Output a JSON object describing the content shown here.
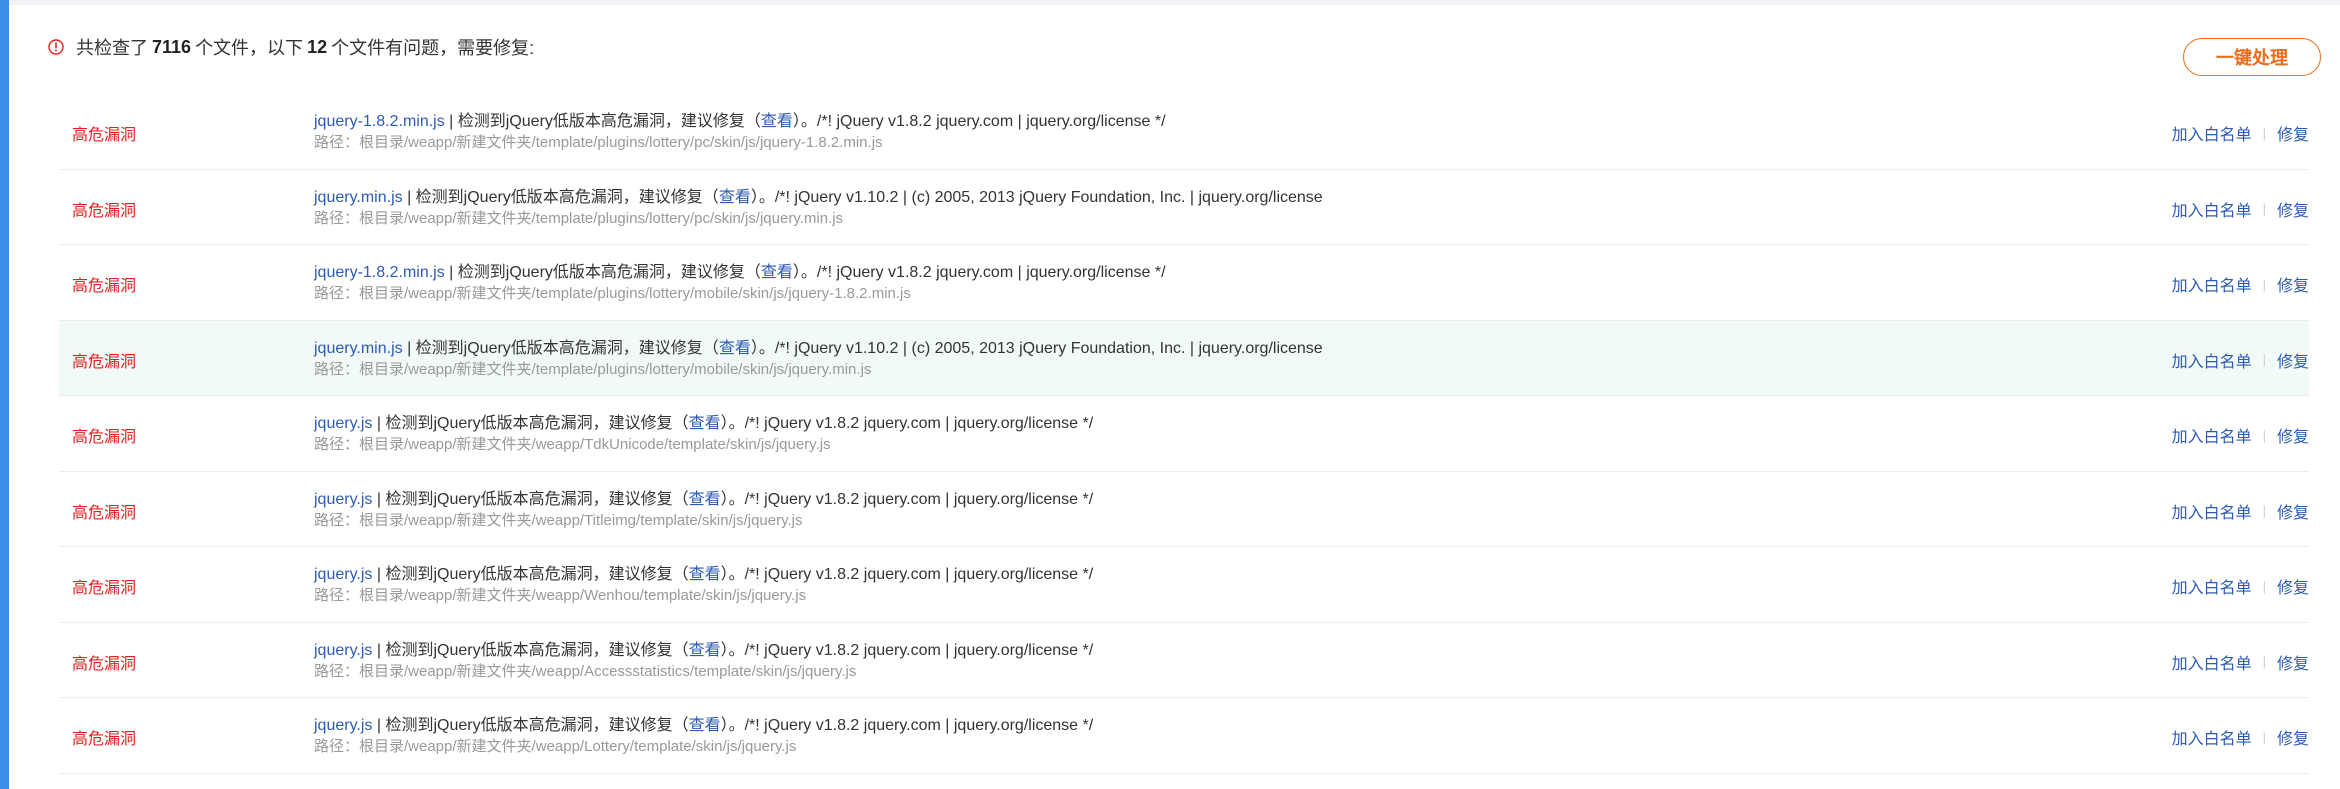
{
  "summary": {
    "prefix": "共检查了",
    "total": "7116",
    "mid": "个文件，以下",
    "issues": "12",
    "suffix": "个文件有问题，需要修复:"
  },
  "colors": {
    "danger": "#e02020",
    "link": "#2d5bb3",
    "accent": "#f06b16",
    "sidebar": "#3a8ee6"
  },
  "icons": {
    "summary": "warning-circle-icon"
  },
  "actions": {
    "one_click": "一键处理",
    "whitelist": "加入白名单",
    "fix": "修复",
    "separator": "|"
  },
  "rows": [
    {
      "level": "高危漏洞",
      "file": "jquery-1.8.2.min.js",
      "sep": " | ",
      "message": "检测到jQuery低版本高危漏洞，建议修复（",
      "view": "查看",
      "after": "）。/*! jQuery v1.8.2 jquery.com | jquery.org/license */",
      "path": "路径：根目录/weapp/新建文件夹/template/plugins/lottery/pc/skin/js/jquery-1.8.2.min.js"
    },
    {
      "level": "高危漏洞",
      "file": "jquery.min.js",
      "sep": " | ",
      "message": "检测到jQuery低版本高危漏洞，建议修复（",
      "view": "查看",
      "after": "）。/*! jQuery v1.10.2 | (c) 2005, 2013 jQuery Foundation, Inc. | jquery.org/license",
      "path": "路径：根目录/weapp/新建文件夹/template/plugins/lottery/pc/skin/js/jquery.min.js"
    },
    {
      "level": "高危漏洞",
      "file": "jquery-1.8.2.min.js",
      "sep": " | ",
      "message": "检测到jQuery低版本高危漏洞，建议修复（",
      "view": "查看",
      "after": "）。/*! jQuery v1.8.2 jquery.com | jquery.org/license */",
      "path": "路径：根目录/weapp/新建文件夹/template/plugins/lottery/mobile/skin/js/jquery-1.8.2.min.js"
    },
    {
      "level": "高危漏洞",
      "file": "jquery.min.js",
      "sep": " | ",
      "message": "检测到jQuery低版本高危漏洞，建议修复（",
      "view": "查看",
      "after": "）。/*! jQuery v1.10.2 | (c) 2005, 2013 jQuery Foundation, Inc. | jquery.org/license",
      "path": "路径：根目录/weapp/新建文件夹/template/plugins/lottery/mobile/skin/js/jquery.min.js"
    },
    {
      "level": "高危漏洞",
      "file": "jquery.js",
      "sep": " | ",
      "message": "检测到jQuery低版本高危漏洞，建议修复（",
      "view": "查看",
      "after": "）。/*! jQuery v1.8.2 jquery.com | jquery.org/license */",
      "path": "路径：根目录/weapp/新建文件夹/weapp/TdkUnicode/template/skin/js/jquery.js"
    },
    {
      "level": "高危漏洞",
      "file": "jquery.js",
      "sep": " | ",
      "message": "检测到jQuery低版本高危漏洞，建议修复（",
      "view": "查看",
      "after": "）。/*! jQuery v1.8.2 jquery.com | jquery.org/license */",
      "path": "路径：根目录/weapp/新建文件夹/weapp/Titleimg/template/skin/js/jquery.js"
    },
    {
      "level": "高危漏洞",
      "file": "jquery.js",
      "sep": " | ",
      "message": "检测到jQuery低版本高危漏洞，建议修复（",
      "view": "查看",
      "after": "）。/*! jQuery v1.8.2 jquery.com | jquery.org/license */",
      "path": "路径：根目录/weapp/新建文件夹/weapp/Wenhou/template/skin/js/jquery.js"
    },
    {
      "level": "高危漏洞",
      "file": "jquery.js",
      "sep": " | ",
      "message": "检测到jQuery低版本高危漏洞，建议修复（",
      "view": "查看",
      "after": "）。/*! jQuery v1.8.2 jquery.com | jquery.org/license */",
      "path": "路径：根目录/weapp/新建文件夹/weapp/Accessstatistics/template/skin/js/jquery.js"
    },
    {
      "level": "高危漏洞",
      "file": "jquery.js",
      "sep": " | ",
      "message": "检测到jQuery低版本高危漏洞，建议修复（",
      "view": "查看",
      "after": "）。/*! jQuery v1.8.2 jquery.com | jquery.org/license */",
      "path": "路径：根目录/weapp/新建文件夹/weapp/Lottery/template/skin/js/jquery.js"
    }
  ]
}
